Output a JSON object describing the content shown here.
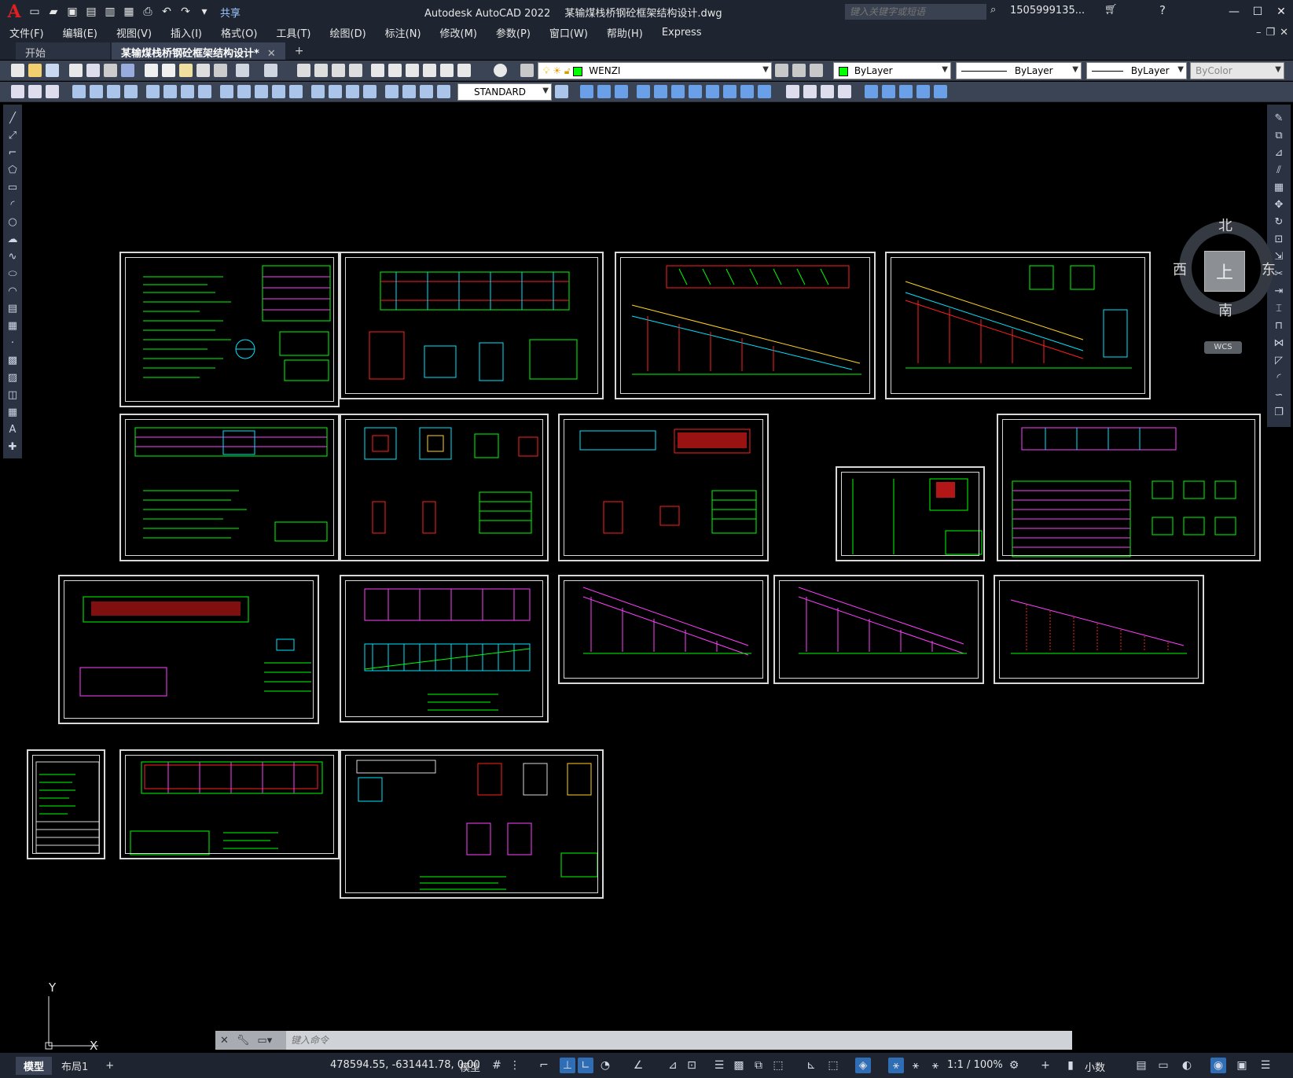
{
  "titlebar": {
    "logo": "A",
    "share_label": "共享",
    "app_name": "Autodesk AutoCAD 2022",
    "file_name": "某输煤栈桥钢砼框架结构设计.dwg",
    "search_placeholder": "键入关键字或短语",
    "user": "1505999135...",
    "window_controls": [
      "minimize-icon",
      "maximize-icon",
      "close-icon"
    ]
  },
  "menu": [
    "文件(F)",
    "编辑(E)",
    "视图(V)",
    "插入(I)",
    "格式(O)",
    "工具(T)",
    "绘图(D)",
    "标注(N)",
    "修改(M)",
    "参数(P)",
    "窗口(W)",
    "帮助(H)",
    "Express"
  ],
  "tabs": {
    "start": "开始",
    "active": "某输煤栈桥钢砼框架结构设计*"
  },
  "toolbar1": {
    "layer": "WENZI",
    "layer_color": "#00ff00",
    "color": "ByLayer",
    "linetype": "ByLayer",
    "lineweight": "ByLayer",
    "plotstyle": "ByColor"
  },
  "toolbar2": {
    "textstyle": "STANDARD"
  },
  "viewcube": {
    "top": "上",
    "north": "北",
    "south": "南",
    "east": "东",
    "west": "西",
    "wcs": "WCS"
  },
  "ucs": {
    "x": "X",
    "y": "Y"
  },
  "command": {
    "placeholder": "键入命令"
  },
  "status": {
    "tabs": [
      "模型",
      "布局1"
    ],
    "coords": "478594.55, -631441.78, 0.00",
    "space": "模型",
    "scale": "1:1 / 100%",
    "units": "小数"
  },
  "colors": {
    "drawing_green": "#00ff00",
    "drawing_red": "#ff2020",
    "drawing_cyan": "#00e5ff",
    "drawing_magenta": "#ff40ff",
    "drawing_yellow": "#ffd21e",
    "frame": "#d8d8d8"
  }
}
